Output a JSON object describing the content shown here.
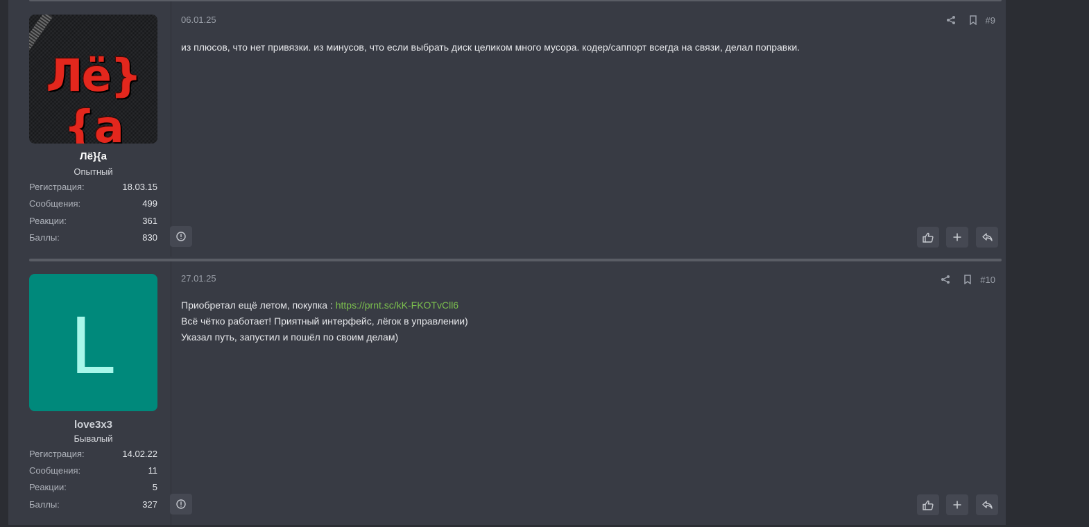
{
  "posts": [
    {
      "user": {
        "name": "Лё}{а",
        "title": "Опытный",
        "avatar_text": "Лё}{а",
        "stats": [
          {
            "label": "Регистрация:",
            "value": "18.03.15"
          },
          {
            "label": "Сообщения:",
            "value": "499"
          },
          {
            "label": "Реакции:",
            "value": "361"
          },
          {
            "label": "Баллы:",
            "value": "830"
          }
        ]
      },
      "date": "06.01.25",
      "number": "#9",
      "lines": [
        {
          "text": "из плюсов, что нет привязки. из минусов, что если выбрать диск целиком много мусора. кодер/саппорт всегда на связи, делал поправки."
        }
      ]
    },
    {
      "user": {
        "name": "love3x3",
        "title": "Бывалый",
        "avatar_letter": "L",
        "avatar_color": "#00897b",
        "stats": [
          {
            "label": "Регистрация:",
            "value": "14.02.22"
          },
          {
            "label": "Сообщения:",
            "value": "11"
          },
          {
            "label": "Реакции:",
            "value": "5"
          },
          {
            "label": "Баллы:",
            "value": "327"
          }
        ]
      },
      "date": "27.01.25",
      "number": "#10",
      "lines": [
        {
          "text": "Приобретал ещё летом, покупка : ",
          "link": "https://prnt.sc/kK-FKOTvCll6"
        },
        {
          "text": "Всё чётко работает! Приятный интерфейс, лёгок в управлении)"
        },
        {
          "text": "Указал путь, запустил и пошёл по своим делам)"
        }
      ]
    }
  ],
  "icons": {
    "share": "share-icon",
    "bookmark": "bookmark-icon",
    "report": "report-icon",
    "like": "thumbs-up-icon",
    "add": "plus-icon",
    "reply": "reply-icon"
  },
  "colors": {
    "link": "#7cc04e",
    "background": "#383b44",
    "avatar_green": "#00897b"
  }
}
